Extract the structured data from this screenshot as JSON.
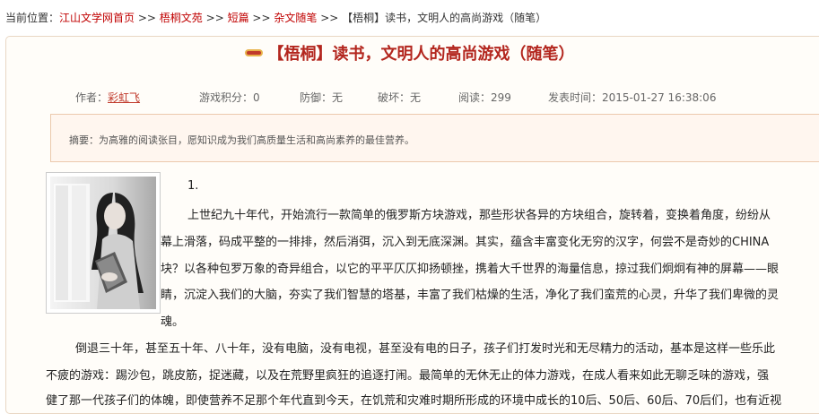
{
  "breadcrumb": {
    "prefix": "当前位置：",
    "items": [
      "江山文学网首页",
      "梧桐文苑",
      "短篇",
      "杂文随笔"
    ],
    "separator": ">>",
    "current": "【梧桐】读书，文明人的高尚游戏（随笔）"
  },
  "article": {
    "title": "【梧桐】读书，文明人的高尚游戏（随笔）",
    "meta": {
      "author_label": "作者：",
      "author": "彩虹飞",
      "score": "游戏积分：0",
      "defense": "防御：无",
      "damage": "破坏：无",
      "reads": "阅读：299",
      "published": "发表时间：2015-01-27 16:38:06"
    },
    "summary": "摘要：为高雅的阅读张目，愿知识成为我们高质量生活和高尚素养的最佳营养。",
    "lines": [
      "1.",
      "上世纪九十年代，开始流行一款简单的俄罗斯方块游戏，那些形状各异的方块组合，旋转着，变换着角度，纷纷从",
      "幕上滑落，码成平整的一排排，然后消弭，沉入到无底深渊。其实，蕴含丰富变化无穷的汉字，何尝不是奇妙的CHINA",
      "块？以各种包罗万象的奇异组合，以它的平平仄仄抑扬顿挫，携着大千世界的海量信息，掠过我们炯炯有神的屏幕——眼",
      "睛，沉淀入我们的大脑，夯实了我们智慧的塔基，丰富了我们枯燥的生活，净化了我们蛮荒的心灵，升华了我们卑微的灵",
      "魂。",
      "倒退三十年，甚至五十年、八十年，没有电脑，没有电视，甚至没有电的日子，孩子们打发时光和无尽精力的活动，基本是这样一些乐此",
      "不疲的游戏：踢沙包，跳皮筋，捉迷藏，以及在荒野里疯狂的追逐打闹。最简单的无休无止的体力游戏，在成人看来如此无聊乏味的游戏，强",
      "健了那一代孩子们的体魄，即使营养不足那个年代直到今天，在饥荒和灾难时期所形成的环境中成长的10后、50后、60后、70后们，也有近视"
    ]
  }
}
